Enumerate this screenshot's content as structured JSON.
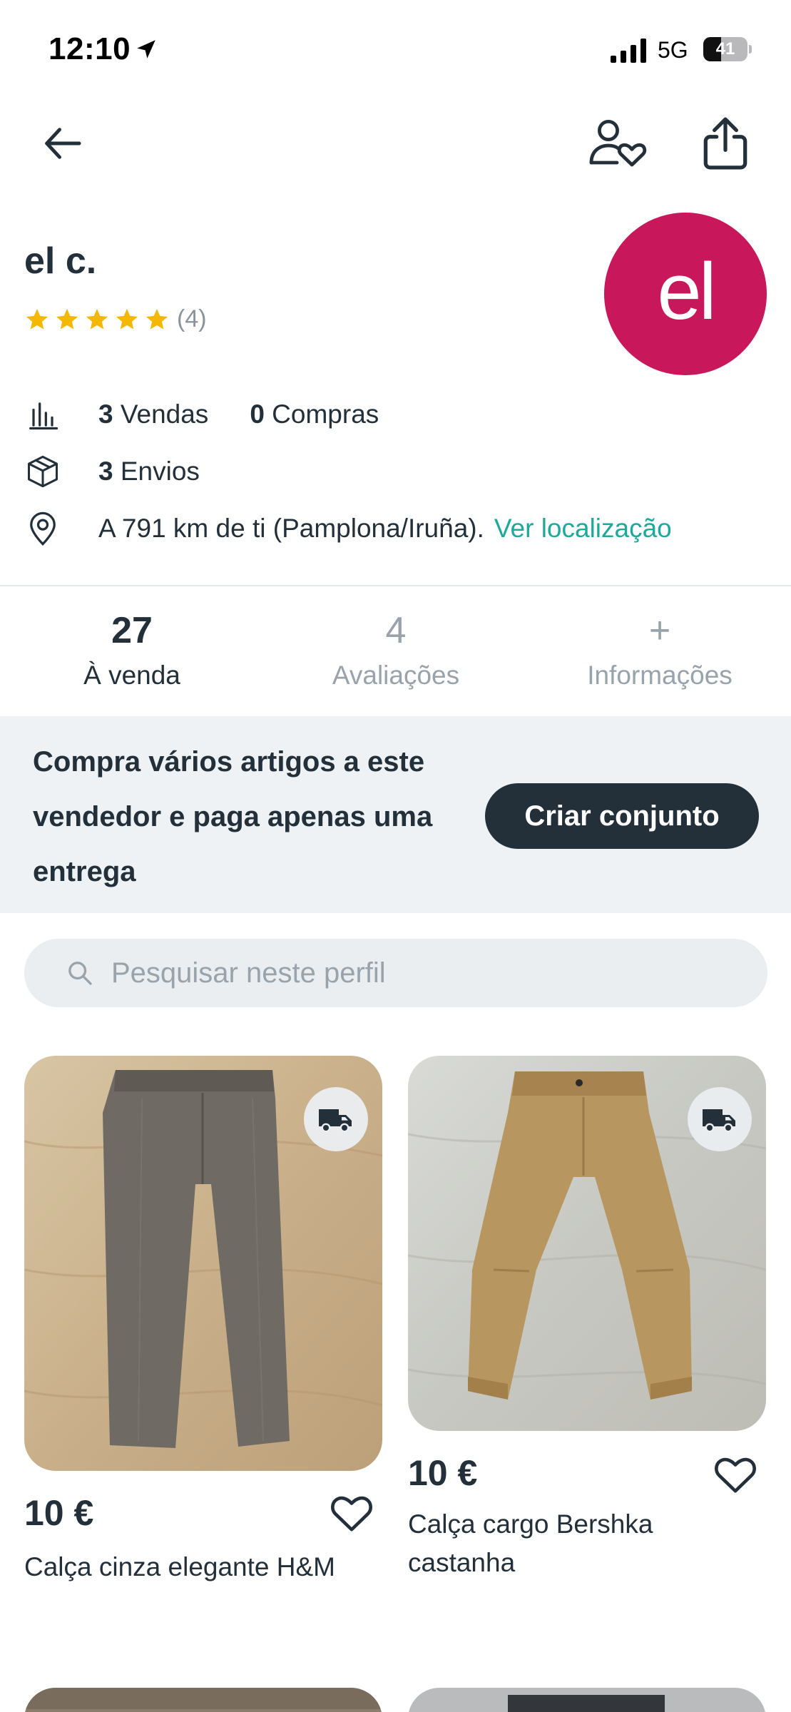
{
  "status_bar": {
    "time": "12:10",
    "network": "5G",
    "battery": "41",
    "battery_level": 0.41
  },
  "nav": {
    "back_icon": "arrow-left-icon",
    "follow_icon": "person-heart-icon",
    "share_icon": "share-icon"
  },
  "profile": {
    "name": "el c.",
    "rating_stars": 5,
    "rating_count": "(4)",
    "avatar_text": "el",
    "avatar_color": "#c8175b"
  },
  "stats": {
    "sales_count": "3",
    "sales_label": "Vendas",
    "purchases_count": "0",
    "purchases_label": "Compras",
    "shipments_count": "3",
    "shipments_label": "Envios",
    "location_text": "A 791 km de ti (Pamplona/Iruña).",
    "location_link": "Ver localização"
  },
  "tabs": [
    {
      "count": "27",
      "label": "À venda",
      "active": true
    },
    {
      "count": "4",
      "label": "Avaliações",
      "active": false
    },
    {
      "count": "+",
      "label": "Informações",
      "active": false
    }
  ],
  "promo": {
    "text": "Compra vários artigos a este vendedor e paga apenas uma entrega",
    "button": "Criar conjunto"
  },
  "search": {
    "placeholder": "Pesquisar neste perfil",
    "value": ""
  },
  "items": [
    {
      "price": "10 €",
      "title": "Calça cinza elegante H&M",
      "color": "#6f6a63"
    },
    {
      "price": "10 €",
      "title": "Calça cargo Bershka castanha",
      "color": "#b8965f"
    }
  ],
  "colors": {
    "accent": "#1ea99a",
    "dark": "#23303a",
    "star": "#f5b800"
  }
}
